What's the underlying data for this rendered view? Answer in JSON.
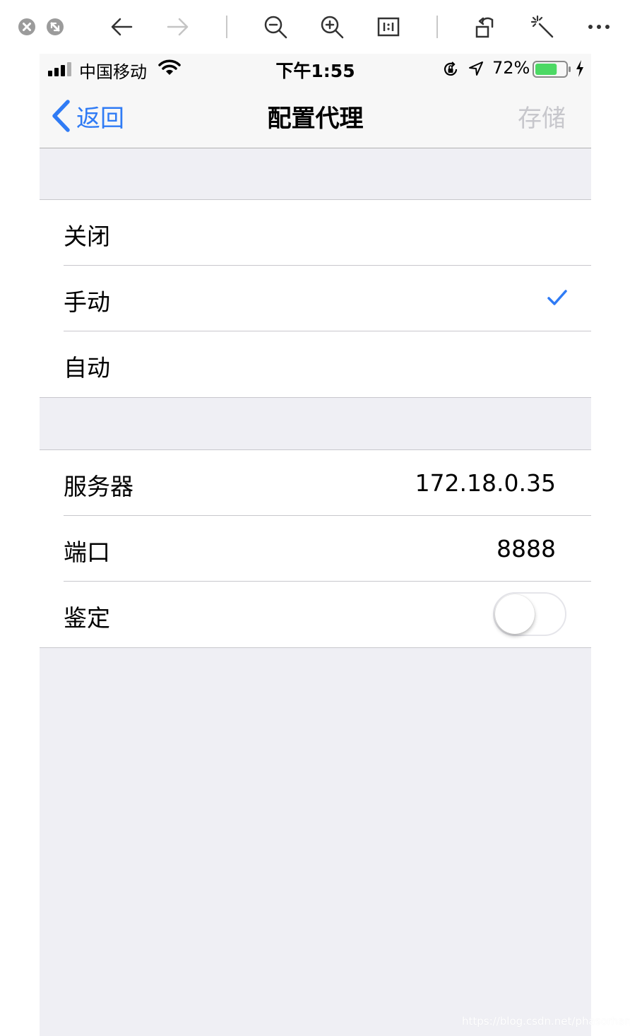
{
  "viewer_toolbar": {
    "icons": [
      "close-icon",
      "exit-fullscreen-icon",
      "back-arrow-icon",
      "forward-arrow-icon",
      "zoom-out-icon",
      "zoom-in-icon",
      "actual-size-icon",
      "rotate-icon",
      "magic-wand-icon",
      "more-icon"
    ]
  },
  "status_bar": {
    "carrier": "中国移动",
    "time": "下午1:55",
    "battery_percent": "72%",
    "battery_level": 0.72,
    "battery_color": "#4cd964"
  },
  "nav": {
    "back_label": "返回",
    "title": "配置代理",
    "save_label": "存储"
  },
  "proxy_modes": {
    "items": [
      {
        "label": "关闭",
        "selected": false
      },
      {
        "label": "手动",
        "selected": true
      },
      {
        "label": "自动",
        "selected": false
      }
    ]
  },
  "manual_settings": {
    "server_label": "服务器",
    "server_value": "172.18.0.35",
    "port_label": "端口",
    "port_value": "8888",
    "auth_label": "鉴定",
    "auth_enabled": false
  },
  "watermark": "https://blog.csdn.net/phasorhand",
  "colors": {
    "accent": "#2f7bf5",
    "disabled": "#c7c7cc",
    "background": "#efeff4"
  }
}
